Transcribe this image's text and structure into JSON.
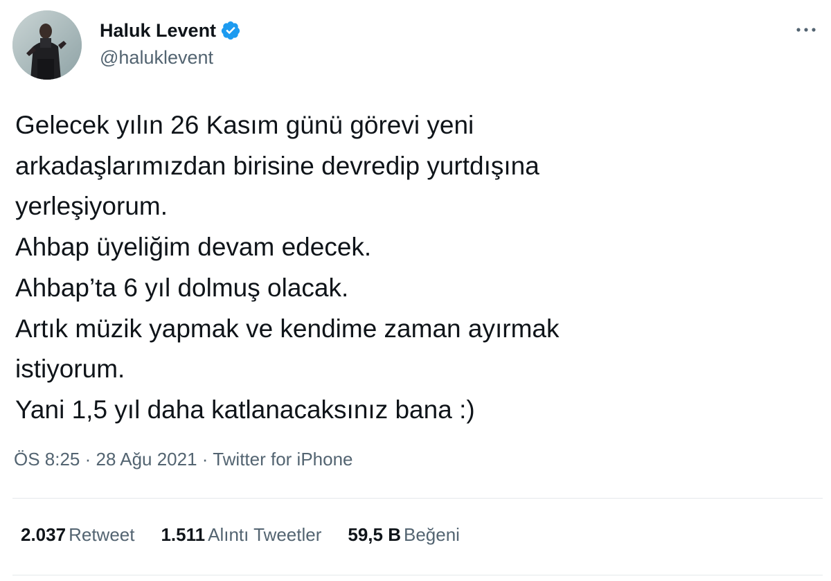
{
  "author": {
    "display_name": "Haluk Levent",
    "handle": "@haluklevent",
    "verified": true,
    "verified_color": "#1d9bf0"
  },
  "tweet": {
    "lines": [
      "Gelecek yılın 26 Kasım günü görevi yeni",
      "arkadaşlarımızdan birisine devredip yurtdışına",
      "yerleşiyorum.",
      "Ahbap üyeliğim devam edecek.",
      "Ahbap’ta 6 yıl dolmuş olacak.",
      "Artık müzik yapmak ve kendime zaman ayırmak",
      "istiyorum.",
      "Yani 1,5 yıl daha katlanacaksınız bana :)"
    ]
  },
  "meta": {
    "time": "ÖS 8:25",
    "separator": " · ",
    "date": "28 Ağu 2021",
    "source": "Twitter for iPhone"
  },
  "stats": {
    "retweets": {
      "count": "2.037",
      "label": "Retweet"
    },
    "quotes": {
      "count": "1.511",
      "label": "Alıntı Tweetler"
    },
    "likes": {
      "count": "59,5 B",
      "label": "Beğeni"
    }
  },
  "icons": {
    "more": "more-horizontal-icon",
    "verified": "verified-badge-icon"
  }
}
